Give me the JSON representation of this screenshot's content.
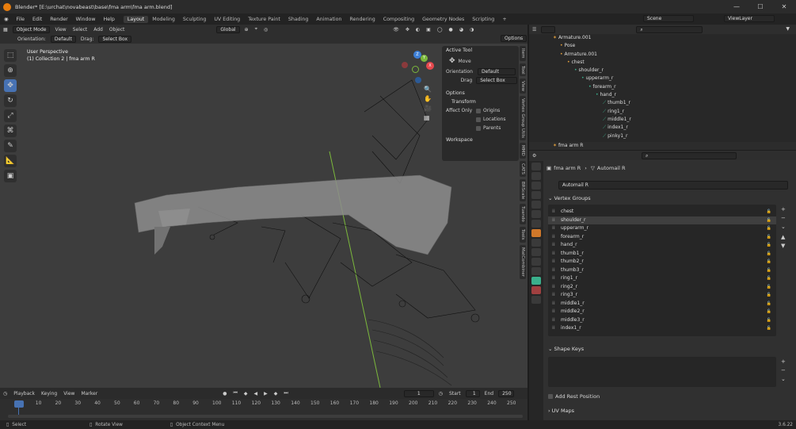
{
  "window": {
    "title": "Blender* [E:\\urchat\\novabeast\\base\\fma arm\\fma arm.blend]",
    "controls": [
      "—",
      "☐",
      "✕"
    ]
  },
  "menu": {
    "items": [
      "File",
      "Edit",
      "Render",
      "Window",
      "Help"
    ],
    "workspaces": [
      "Layout",
      "Modeling",
      "Sculpting",
      "UV Editing",
      "Texture Paint",
      "Shading",
      "Animation",
      "Rendering",
      "Compositing",
      "Geometry Nodes",
      "Scripting"
    ],
    "active_workspace": "Layout",
    "add_tab": "+",
    "scene_label": "Scene",
    "viewlayer_label": "ViewLayer"
  },
  "viewport": {
    "mode": "Object Mode",
    "menus": [
      "View",
      "Select",
      "Add",
      "Object"
    ],
    "orientation_label": "Orientation:",
    "orientation_value": "Default",
    "drag_label": "Drag:",
    "drag_value": "Select Box",
    "transform_orientation": "Global",
    "options_label": "Options",
    "perspective_text": "User Perspective",
    "collection_text": "(1) Collection 2 | fma arm R",
    "axis_x": "X",
    "axis_y": "Y",
    "axis_z": "Z"
  },
  "npanel": {
    "active_tool_header": "Active Tool",
    "tool_name": "Move",
    "orientation_label": "Orientation",
    "orientation_value": "Default",
    "drag_label": "Drag",
    "drag_value": "Select Box",
    "options_header": "Options",
    "transform_header": "Transform",
    "affect_only_label": "Affect Only",
    "affect_options": [
      "Origins",
      "Locations",
      "Parents"
    ],
    "workspace_header": "Workspace"
  },
  "side_tabs": [
    "Item",
    "Tool",
    "View",
    "Vertex Group Utils",
    "MMD",
    "CATS",
    "BRScale",
    "Tuando",
    "Tools",
    "MatCombiner"
  ],
  "timeline": {
    "menus": [
      "Playback",
      "Keying",
      "View",
      "Marker"
    ],
    "current_frame": "1",
    "start_label": "Start",
    "start_value": "1",
    "end_label": "End",
    "end_value": "250",
    "ruler_marks": [
      "1",
      "10",
      "20",
      "30",
      "40",
      "50",
      "60",
      "70",
      "80",
      "90",
      "100",
      "110",
      "120",
      "130",
      "140",
      "150",
      "160",
      "170",
      "180",
      "190",
      "200",
      "210",
      "220",
      "230",
      "240",
      "250"
    ]
  },
  "status": {
    "select": "Select",
    "rotate": "Rotate View",
    "context": "Object Context Menu",
    "version": "3.6.22"
  },
  "outliner": {
    "rows": [
      {
        "label": "Armature.001",
        "indent": 0
      },
      {
        "label": "Pose",
        "indent": 1
      },
      {
        "label": "Armature.001",
        "indent": 1
      },
      {
        "label": "chest",
        "indent": 2
      },
      {
        "label": "shoulder_r",
        "indent": 3
      },
      {
        "label": "upperarm_r",
        "indent": 4
      },
      {
        "label": "forearm_r",
        "indent": 5
      },
      {
        "label": "hand_r",
        "indent": 6
      },
      {
        "label": "thumb1_r",
        "indent": 7
      },
      {
        "label": "ring1_r",
        "indent": 7
      },
      {
        "label": "middle1_r",
        "indent": 7
      },
      {
        "label": "index1_r",
        "indent": 7
      },
      {
        "label": "pinky1_r",
        "indent": 7
      },
      {
        "label": "fma arm R",
        "indent": 0
      }
    ]
  },
  "properties": {
    "object_name": "fma arm R",
    "mesh_name": "Automail R",
    "mesh_field": "Automail R",
    "vertex_groups_header": "Vertex Groups",
    "vertex_groups": [
      "chest",
      "shoulder_r",
      "upperarm_r",
      "forearm_r",
      "hand_r",
      "thumb1_r",
      "thumb2_r",
      "thumb3_r",
      "ring1_r",
      "ring2_r",
      "ring3_r",
      "middle1_r",
      "middle2_r",
      "middle3_r",
      "index1_r"
    ],
    "selected_group": "shoulder_r",
    "shape_keys_header": "Shape Keys",
    "add_rest_label": "Add Rest Position",
    "uv_maps_header": "UV Maps"
  },
  "colors": {
    "accent": "#4772b3",
    "axis_x": "#e5484d",
    "axis_y": "#7bb83c",
    "axis_z": "#3d7fd6",
    "bone_green": "#3ab08c"
  }
}
